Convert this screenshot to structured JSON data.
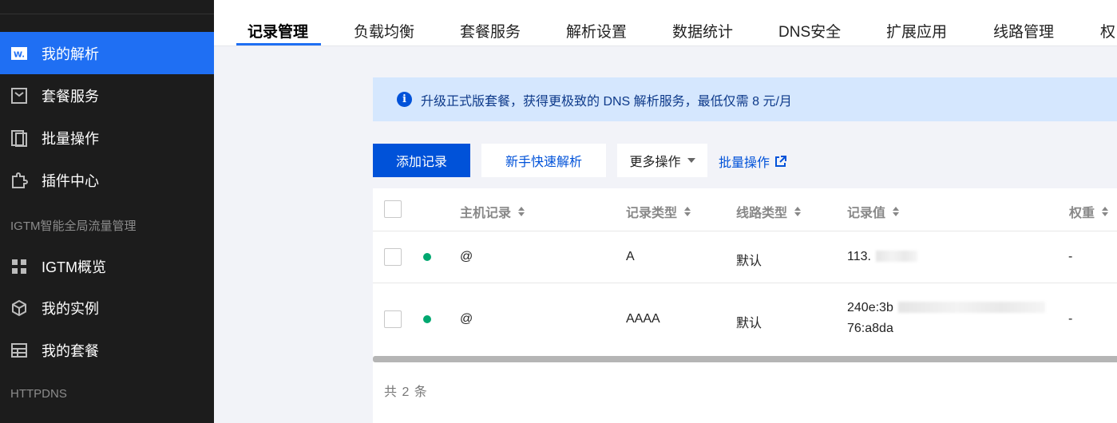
{
  "sidebar": {
    "items": [
      {
        "label": "我的解析",
        "icon": "dns-w-icon"
      },
      {
        "label": "套餐服务",
        "icon": "package-icon"
      },
      {
        "label": "批量操作",
        "icon": "copy-stack-icon"
      },
      {
        "label": "插件中心",
        "icon": "puzzle-icon"
      },
      {
        "label": "IGTM概览",
        "icon": "grid-icon"
      },
      {
        "label": "我的实例",
        "icon": "cube-icon"
      },
      {
        "label": "我的套餐",
        "icon": "table-icon"
      }
    ],
    "sections": [
      "IGTM智能全局流量管理",
      "HTTPDNS"
    ]
  },
  "tabs": [
    "记录管理",
    "负载均衡",
    "套餐服务",
    "解析设置",
    "数据统计",
    "DNS安全",
    "扩展应用",
    "线路管理",
    "权"
  ],
  "banner": {
    "text": "升级正式版套餐，获得更极致的 DNS 解析服务，最低仅需 8 元/月"
  },
  "toolbar": {
    "add_label": "添加记录",
    "quick_label": "新手快速解析",
    "more_label": "更多操作",
    "batch_label": "批量操作"
  },
  "table": {
    "headers": [
      "主机记录",
      "记录类型",
      "线路类型",
      "记录值",
      "权重"
    ],
    "rows": [
      {
        "host": "@",
        "type": "A",
        "line": "默认",
        "value": "113.",
        "value2": "",
        "weight": "-"
      },
      {
        "host": "@",
        "type": "AAAA",
        "line": "默认",
        "value": "240e:3b",
        "value2": "76:a8da",
        "weight": "-"
      }
    ],
    "total": "共 2 条"
  },
  "colors": {
    "accent": "#0052d9",
    "sidebar_bg": "#1c1c1c",
    "active_nav": "#1f6ff3",
    "status_ok": "#00a870"
  }
}
